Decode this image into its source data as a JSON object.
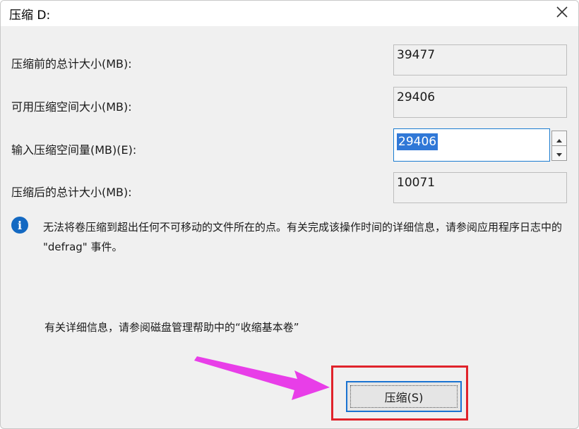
{
  "window": {
    "title": "压缩 D:",
    "close_icon": "close-icon"
  },
  "rows": [
    {
      "label": "压缩前的总计大小(MB):",
      "value": "39477"
    },
    {
      "label": "可用压缩空间大小(MB):",
      "value": "29406"
    },
    {
      "label": "输入压缩空间量(MB)(E):",
      "value": "29406"
    },
    {
      "label": "压缩后的总计大小(MB):",
      "value": "10071"
    }
  ],
  "info": {
    "icon": "info-icon",
    "text": "无法将卷压缩到超出任何不可移动的文件所在的点。有关完成该操作时间的详细信息，请参阅应用程序日志中的 \"defrag\" 事件。",
    "more": "有关详细信息，请参阅磁盘管理帮助中的“收缩基本卷”"
  },
  "buttons": {
    "shrink": "压缩(S)"
  },
  "colors": {
    "highlight": "#e0232b",
    "arrow": "#e83ee8",
    "accent": "#1a73d1"
  }
}
